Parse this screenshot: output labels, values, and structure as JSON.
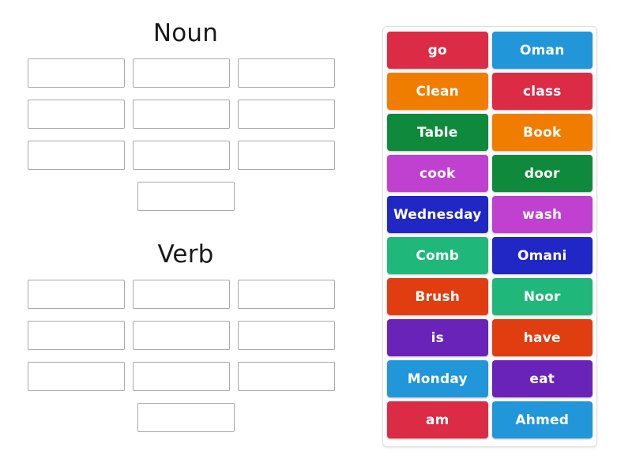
{
  "activity": {
    "type": "word-sort-drag-and-drop",
    "categories": [
      {
        "title": "Noun",
        "dropzone_count": 10,
        "rows": [
          3,
          3,
          3,
          1
        ]
      },
      {
        "title": "Verb",
        "dropzone_count": 10,
        "rows": [
          3,
          3,
          3,
          1
        ]
      }
    ]
  },
  "tray": {
    "tiles": [
      {
        "label": "go",
        "color": "#db2b45"
      },
      {
        "label": "Oman",
        "color": "#2196d9"
      },
      {
        "label": "Clean",
        "color": "#f07d00"
      },
      {
        "label": "class",
        "color": "#db2b45"
      },
      {
        "label": "Table",
        "color": "#0f8a3d"
      },
      {
        "label": "Book",
        "color": "#f07d00"
      },
      {
        "label": "cook",
        "color": "#c040d0"
      },
      {
        "label": "door",
        "color": "#0f8a3d"
      },
      {
        "label": "Wednesday",
        "color": "#2127c4"
      },
      {
        "label": "wash",
        "color": "#c040d0"
      },
      {
        "label": "Comb",
        "color": "#1fb87a"
      },
      {
        "label": "Omani",
        "color": "#2127c4"
      },
      {
        "label": "Brush",
        "color": "#e03e11"
      },
      {
        "label": "Noor",
        "color": "#1fb87a"
      },
      {
        "label": "is",
        "color": "#6a23b8"
      },
      {
        "label": "have",
        "color": "#e03e11"
      },
      {
        "label": "Monday",
        "color": "#2196d9"
      },
      {
        "label": "eat",
        "color": "#6a23b8"
      },
      {
        "label": "am",
        "color": "#db2b45"
      },
      {
        "label": "Ahmed",
        "color": "#2196d9"
      }
    ]
  },
  "palette": {
    "crimson": "#db2b45",
    "light_blue": "#2196d9",
    "orange": "#f07d00",
    "green": "#0f8a3d",
    "magenta": "#c040d0",
    "dark_blue": "#2127c4",
    "teal_green": "#1fb87a",
    "red_orange": "#e03e11",
    "purple": "#6a23b8",
    "page_background": "#ffffff",
    "dropzone_border": "#a9a9a9",
    "tray_border": "#dedede",
    "title_text": "#1a1a1a",
    "tile_text": "#ffffff"
  }
}
